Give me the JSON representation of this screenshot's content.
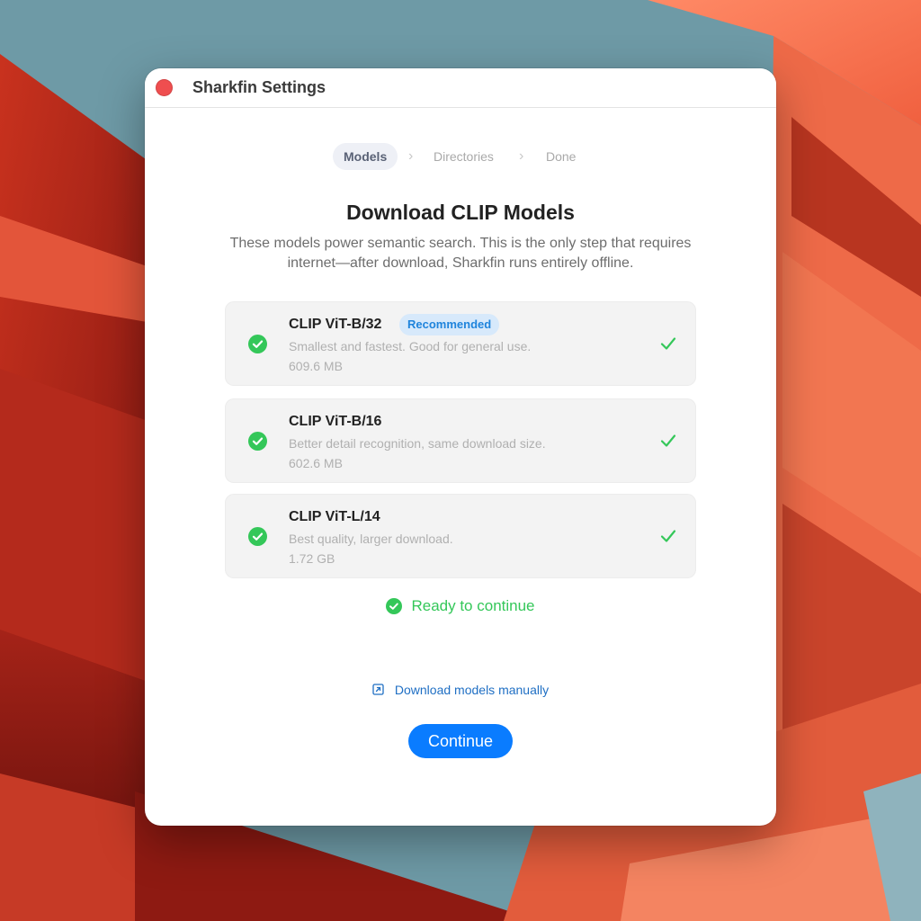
{
  "window": {
    "title": "Sharkfin Settings"
  },
  "steps": [
    {
      "label": "Models",
      "state": "active"
    },
    {
      "label": "Directories",
      "state": "pending"
    },
    {
      "label": "Done",
      "state": "pending"
    }
  ],
  "step_separator_icon": "chevron-right-icon",
  "main": {
    "heading": "Download CLIP Models",
    "description": "These models power semantic search. This is the only step that requires internet—after download, Sharkfin runs entirely offline."
  },
  "models": [
    {
      "name": "CLIP ViT-B/32",
      "badge": "Recommended",
      "description": "Smallest and fastest. Good for general use.",
      "size": "609.6 MB",
      "status_icon": "check-circle-icon",
      "done_icon": "checkmark-icon"
    },
    {
      "name": "CLIP ViT-B/16",
      "description": "Better detail recognition, same download size.",
      "size": "602.6 MB",
      "status_icon": "check-circle-icon",
      "done_icon": "checkmark-icon"
    },
    {
      "name": "CLIP ViT-L/14",
      "description": "Best quality, larger download.",
      "size": "1.72 GB",
      "status_icon": "check-circle-icon",
      "done_icon": "checkmark-icon"
    }
  ],
  "status": {
    "text": "Ready to continue",
    "icon": "check-circle-icon"
  },
  "manual_link": {
    "text": "Download models manually",
    "icon": "external-link-icon"
  },
  "continue_label": "Continue",
  "colors": {
    "accent": "#0a7cff",
    "success": "#34c759",
    "close_button": "#ef4e4f",
    "badge_bg": "#d7e9fb",
    "badge_text": "#1f84dc",
    "link": "#1f6fc4"
  }
}
